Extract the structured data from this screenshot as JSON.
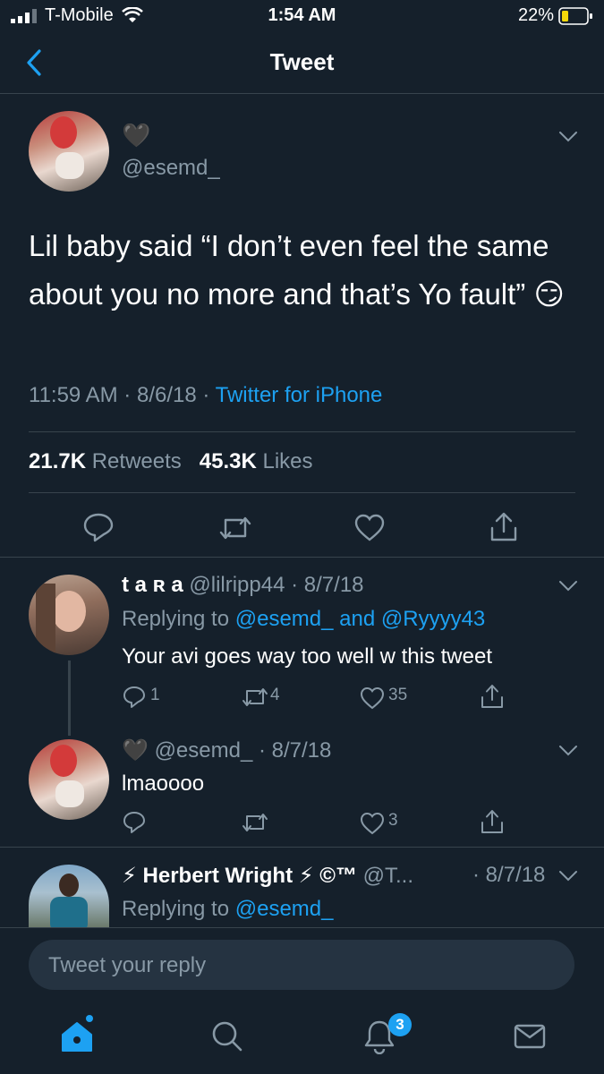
{
  "status": {
    "carrier": "T-Mobile",
    "time": "1:54 AM",
    "battery": "22%"
  },
  "nav": {
    "title": "Tweet"
  },
  "main_tweet": {
    "name": "🖤",
    "handle": "@esemd_",
    "text": "Lil baby said “I don’t even feel the same about you no more and that’s Yo fault” 😏",
    "time": "11:59 AM",
    "date": "8/6/18",
    "source": "Twitter for iPhone",
    "retweets_count": "21.7K",
    "retweets_label": "Retweets",
    "likes_count": "45.3K",
    "likes_label": "Likes"
  },
  "replies": [
    {
      "name": "t a ʀ a",
      "handle": "@lilripp44",
      "date": "8/7/18",
      "replying_prefix": "Replying to",
      "replying_to_1": "@esemd_",
      "replying_and": "and",
      "replying_to_2": "@Ryyyy43",
      "text": "Your avi goes way too well w this tweet",
      "replies": "1",
      "retweets": "4",
      "likes": "35"
    },
    {
      "name": "🖤",
      "handle": "@esemd_",
      "date": "8/7/18",
      "text": "lmaoooo",
      "likes": "3"
    },
    {
      "name": "⚡ Herbert Wright ⚡ ©™",
      "handle": "@T...",
      "date": "8/7/18",
      "replying_prefix": "Replying to",
      "replying_to_1": "@esemd_"
    }
  ],
  "composer": {
    "placeholder": "Tweet your reply"
  },
  "tabbar": {
    "notifications_badge": "3"
  },
  "colors": {
    "background": "#15202b",
    "accent": "#1da1f2",
    "muted": "#8899a6",
    "divider": "#38444d"
  }
}
